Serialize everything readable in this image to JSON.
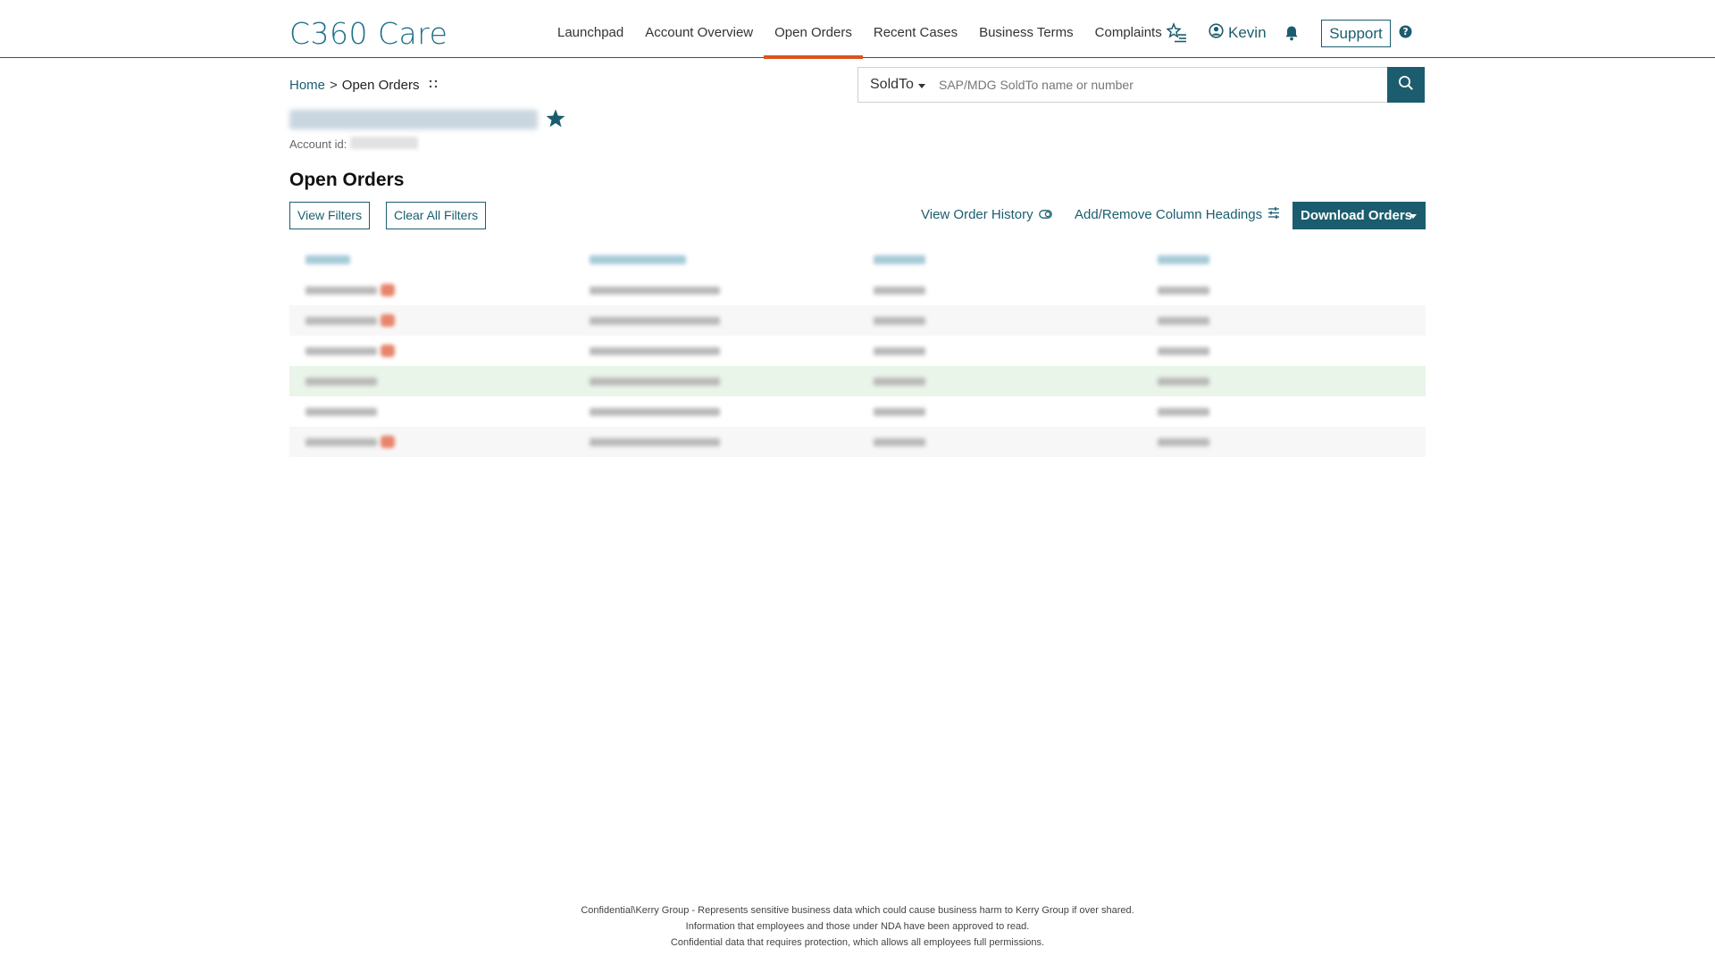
{
  "app": {
    "title": "C360 Care"
  },
  "nav": {
    "items": [
      "Launchpad",
      "Account Overview",
      "Open Orders",
      "Recent Cases",
      "Business Terms",
      "Complaints"
    ],
    "active": "Open Orders",
    "user_label": "Kevin",
    "support_label": "Support",
    "icons": [
      "favorites-list-icon",
      "user-circle-icon",
      "bell-icon",
      "help-circle-icon"
    ]
  },
  "breadcrumb": {
    "home": "Home",
    "separator": ">",
    "current": "Open Orders"
  },
  "account": {
    "id_label": "Account id:"
  },
  "search": {
    "type_label": "SoldTo",
    "placeholder": "SAP/MDG SoldTo name or number"
  },
  "page": {
    "title": "Open Orders"
  },
  "actions": {
    "view_filters": "View Filters",
    "clear_filters": "Clear All Filters",
    "view_history": "View Order History",
    "column_headings": "Add/Remove Column Headings",
    "download": "Download Orders"
  },
  "table": {
    "column_count": 4,
    "row_count": 6,
    "rows_with_badge": [
      true,
      true,
      true,
      false,
      false,
      true
    ],
    "highlighted_row": 4
  },
  "footer": {
    "lines": [
      "Confidential\\Kerry Group - Represents sensitive business data which could cause business harm to Kerry Group if over shared.",
      "Information that employees and those under NDA have been approved to read.",
      "Confidential data that requires protection, which allows all employees full permissions."
    ]
  },
  "colors": {
    "brand": "#1b5d6e",
    "logo": "#1d6f87",
    "active_underline": "#d9541e",
    "badge": "#e8846b",
    "highlight_row": "#eaf5ea"
  }
}
